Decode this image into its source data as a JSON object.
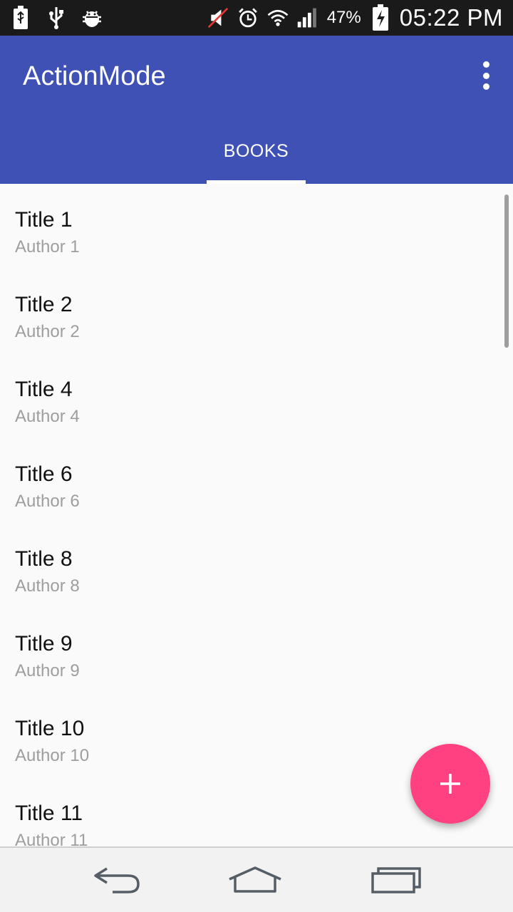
{
  "status_bar": {
    "battery_percent": "47%",
    "time": "05:22 PM"
  },
  "app_bar": {
    "title": "ActionMode",
    "overflow_icon": "more-vert-icon",
    "color": "#3f51b5"
  },
  "tabs": [
    {
      "label": "BOOKS",
      "selected": true
    }
  ],
  "books": [
    {
      "title": "Title 1",
      "author": "Author 1"
    },
    {
      "title": "Title 2",
      "author": "Author 2"
    },
    {
      "title": "Title 4",
      "author": "Author 4"
    },
    {
      "title": "Title 6",
      "author": "Author 6"
    },
    {
      "title": "Title 8",
      "author": "Author 8"
    },
    {
      "title": "Title 9",
      "author": "Author 9"
    },
    {
      "title": "Title 10",
      "author": "Author 10"
    },
    {
      "title": "Title 11",
      "author": "Author 11"
    }
  ],
  "fab": {
    "icon": "plus-icon",
    "color": "#ff4081"
  },
  "nav_bar": {
    "back_icon": "back-icon",
    "home_icon": "home-icon",
    "recents_icon": "recents-icon"
  }
}
